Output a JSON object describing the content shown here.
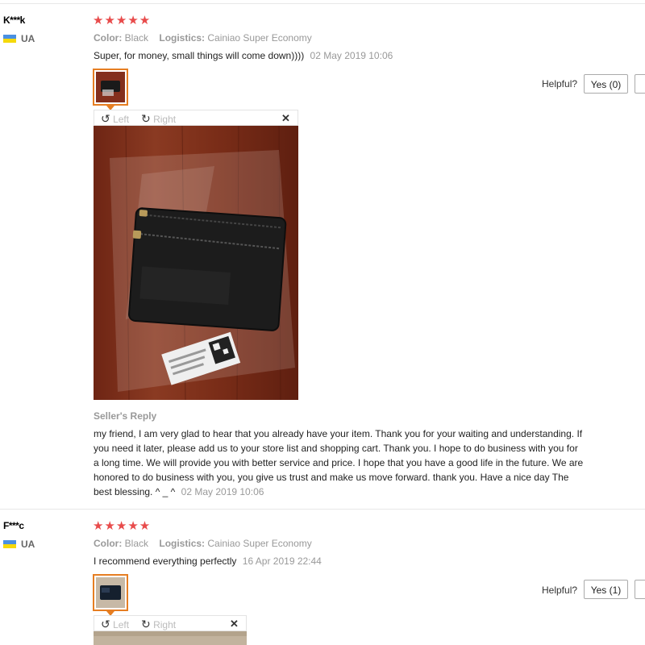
{
  "reviews": [
    {
      "reviewer": "K***k",
      "country": "UA",
      "stars": "★★★★★",
      "color_label": "Color:",
      "color_value": "Black",
      "logistics_label": "Logistics:",
      "logistics_value": "Cainiao Super Economy",
      "text": "Super, for money, small things will come down))))",
      "date": "02 May 2019 10:06",
      "helpful_label": "Helpful?",
      "yes_label": "Yes (0)",
      "viewer": {
        "left": "Left",
        "right": "Right"
      },
      "seller_reply_title": "Seller's Reply",
      "seller_reply": "my friend, I am very glad to hear that you already have your item. Thank you for your waiting and understanding. If you need it later, please add us to your store list and shopping cart. Thank you. I hope to do business with you for a long time. We will provide you with better service and price. I hope that you have a good life in the future. We are honored to do business with you, you give us trust and make us move forward. thank you. Have a nice day The best blessing. ^ _ ^",
      "seller_reply_date": "02 May 2019 10:06"
    },
    {
      "reviewer": "F***c",
      "country": "UA",
      "stars": "★★★★★",
      "color_label": "Color:",
      "color_value": "Black",
      "logistics_label": "Logistics:",
      "logistics_value": "Cainiao Super Economy",
      "text": "I recommend everything perfectly",
      "date": "16 Apr 2019 22:44",
      "helpful_label": "Helpful?",
      "yes_label": "Yes (1)",
      "viewer": {
        "left": "Left",
        "right": "Right"
      }
    }
  ],
  "colors": {
    "accent": "#e67e22",
    "star": "#e84b4b"
  },
  "icons": {
    "rotate_left": "rotate-left-icon",
    "rotate_right": "rotate-right-icon",
    "close": "close-icon"
  }
}
